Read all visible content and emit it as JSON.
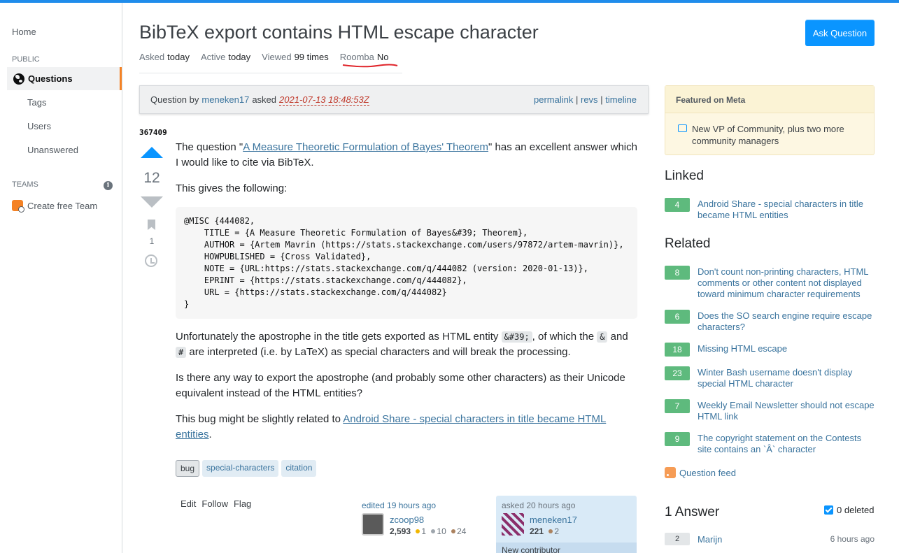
{
  "sidebar": {
    "home": "Home",
    "public_label": "PUBLIC",
    "questions": "Questions",
    "tags": "Tags",
    "users": "Users",
    "unanswered": "Unanswered",
    "teams_label": "TEAMS",
    "create_team": "Create free Team"
  },
  "question": {
    "title": "BibTeX export contains HTML escape character",
    "ask_button": "Ask Question",
    "meta": {
      "asked_label": "Asked",
      "asked_value": "today",
      "active_label": "Active",
      "active_value": "today",
      "viewed_label": "Viewed",
      "viewed_value": "99 times",
      "roomba_label": "Roomba",
      "roomba_value": "No"
    },
    "banner": {
      "prefix": "Question by",
      "user": "meneken17",
      "asked": "asked",
      "timestamp": "2021-07-13 18:48:53Z",
      "permalink": "permalink",
      "revs": "revs",
      "timeline": "timeline",
      "sep": "|"
    },
    "id": "367409",
    "votes": "12",
    "bookmarks": "1",
    "body": {
      "p1_pre": "The question \"",
      "p1_link": "A Measure Theoretic Formulation of Bayes' Theorem",
      "p1_post": "\" has an excellent answer which I would like to cite via BibTeX.",
      "p2": "This gives the following:",
      "code": "@MISC {444082,\n    TITLE = {A Measure Theoretic Formulation of Bayes&#39; Theorem},\n    AUTHOR = {Artem Mavrin (https://stats.stackexchange.com/users/97872/artem-mavrin)},\n    HOWPUBLISHED = {Cross Validated},\n    NOTE = {URL:https://stats.stackexchange.com/q/444082 (version: 2020-01-13)},\n    EPRINT = {https://stats.stackexchange.com/q/444082},\n    URL = {https://stats.stackexchange.com/q/444082}\n}",
      "p3_a": "Unfortunately the apostrophe in the title gets exported as HTML entity ",
      "p3_code1": "&#39;",
      "p3_b": ", of which the ",
      "p3_code2": "&",
      "p3_c": " and ",
      "p3_code3": "#",
      "p3_d": " are interpreted (i.e. by LaTeX) as special characters and will break the processing.",
      "p4": "Is there any way to export the apostrophe (and probably some other characters) as their Unicode equivalent instead of the HTML entities?",
      "p5_pre": "This bug might be slightly related to ",
      "p5_link": "Android Share - special characters in title became HTML entities",
      "p5_post": "."
    },
    "tags": [
      "bug",
      "special-characters",
      "citation"
    ],
    "menu": [
      "Edit",
      "Follow",
      "Flag"
    ],
    "editor": {
      "label": "edited 19 hours ago",
      "name": "zcoop98",
      "rep": "2,593",
      "gold": "1",
      "silver": "10",
      "bronze": "24"
    },
    "owner": {
      "label": "asked 20 hours ago",
      "name": "meneken17",
      "rep": "221",
      "bronze": "2",
      "new_contributor": "New contributor"
    }
  },
  "right": {
    "featured_title": "Featured on Meta",
    "featured_item": "New VP of Community, plus two more community managers",
    "linked_title": "Linked",
    "linked": [
      {
        "score": "4",
        "title": "Android Share - special characters in title became HTML entities"
      }
    ],
    "related_title": "Related",
    "related": [
      {
        "score": "8",
        "title": "Don't count non-printing characters, HTML comments or other content not displayed toward minimum character requirements"
      },
      {
        "score": "6",
        "title": "Does the SO search engine require escape characters?"
      },
      {
        "score": "18",
        "title": "Missing HTML escape"
      },
      {
        "score": "23",
        "title": "Winter Bash username doesn't display special HTML character"
      },
      {
        "score": "7",
        "title": "Weekly Email Newsletter should not escape HTML link"
      },
      {
        "score": "9",
        "title": "The copyright statement on the Contests site contains an `Â` character"
      }
    ],
    "feed": "Question feed",
    "answers_title": "1 Answer",
    "deleted_label": "0 deleted",
    "answer": {
      "score": "2",
      "user": "Marijn",
      "time": "6 hours ago"
    }
  },
  "colors": {
    "accent": "#0a95ff",
    "answered_score": "#5eba7d",
    "nav_active_border": "#f48225",
    "roomba_underline": "#e0242a"
  },
  "icons": [
    "globe-icon",
    "info-icon",
    "team-icon",
    "bookmark-icon",
    "history-icon",
    "chat-icon",
    "rss-icon",
    "checkbox-icon"
  ]
}
